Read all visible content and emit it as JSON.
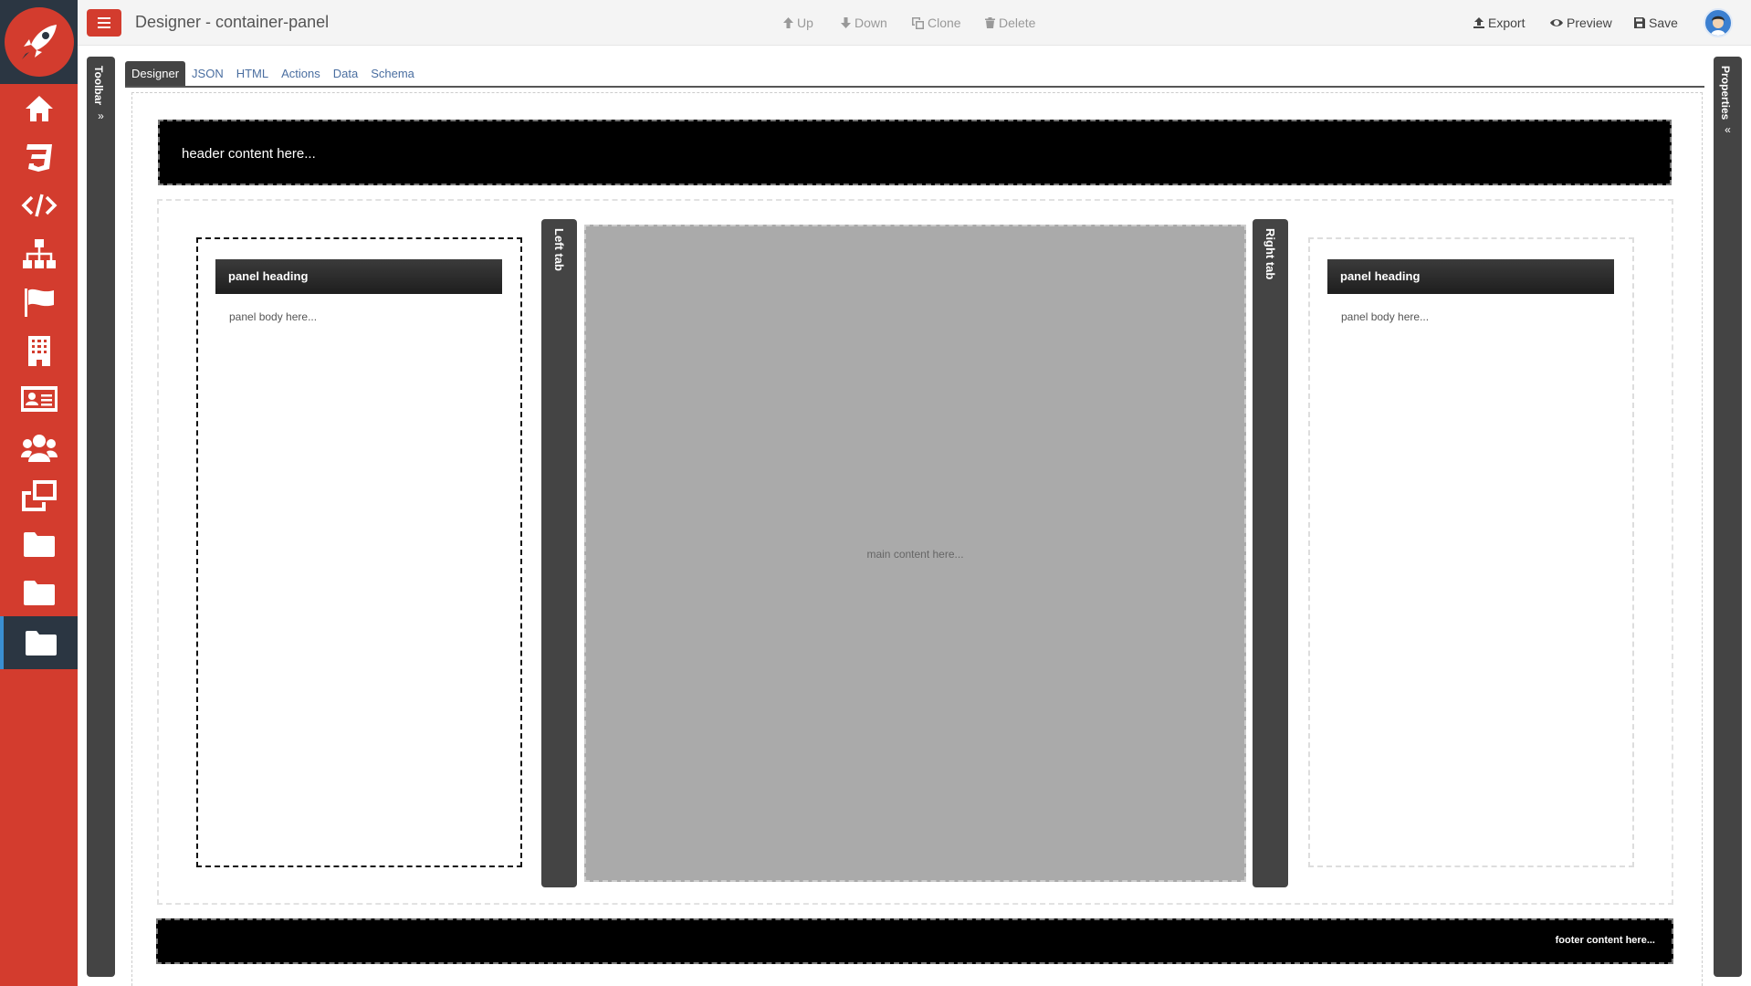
{
  "app": {
    "title": "Designer - container-panel"
  },
  "toolbar": {
    "up": "Up",
    "down": "Down",
    "clone": "Clone",
    "delete": "Delete",
    "export": "Export",
    "preview": "Preview",
    "save": "Save"
  },
  "left_bar": {
    "label": "Toolbar",
    "chevron": "»"
  },
  "right_bar": {
    "label": "Properties",
    "chevron": "«"
  },
  "tabs": [
    {
      "label": "Designer",
      "active": true
    },
    {
      "label": "JSON"
    },
    {
      "label": "HTML"
    },
    {
      "label": "Actions"
    },
    {
      "label": "Data"
    },
    {
      "label": "Schema"
    }
  ],
  "sidebar": {
    "items": [
      {
        "icon": "home-icon"
      },
      {
        "icon": "css3-icon"
      },
      {
        "icon": "code-icon"
      },
      {
        "icon": "sitemap-icon"
      },
      {
        "icon": "flag-icon"
      },
      {
        "icon": "building-icon"
      },
      {
        "icon": "address-card-icon"
      },
      {
        "icon": "users-icon"
      },
      {
        "icon": "clone-icon"
      },
      {
        "icon": "folder-icon"
      },
      {
        "icon": "folder-icon"
      },
      {
        "icon": "folder-icon",
        "active": true
      }
    ]
  },
  "layout": {
    "header": "header content here...",
    "footer": "footer content here...",
    "main": "main content here...",
    "left_tab": "Left tab",
    "right_tab": "Right tab",
    "left_panel": {
      "heading": "panel heading",
      "body": "panel body here..."
    },
    "right_panel": {
      "heading": "panel heading",
      "body": "panel body here..."
    }
  },
  "colors": {
    "brand_red": "#d33c2e",
    "dark_navy": "#2b3642",
    "panel_dark": "#444444"
  }
}
